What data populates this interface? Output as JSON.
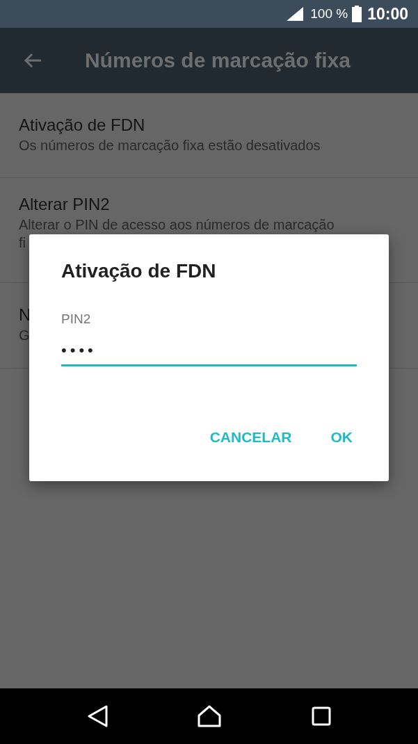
{
  "status_bar": {
    "battery": "100 %",
    "time": "10:00"
  },
  "toolbar": {
    "title": "Números de marcação fixa"
  },
  "list": [
    {
      "title": "Ativação de FDN",
      "summary": [
        "Os números de marcação fixa estão desativados"
      ]
    },
    {
      "title": "Alterar PIN2",
      "summary": [
        "Alterar o PIN de acesso aos números de marcação",
        "fi"
      ]
    },
    {
      "title": "N",
      "summary": [
        "G"
      ]
    }
  ],
  "dialog": {
    "title": "Ativação de FDN",
    "field": {
      "label": "PIN2",
      "value": "••••"
    },
    "buttons": [
      "CANCELAR",
      "OK"
    ]
  }
}
